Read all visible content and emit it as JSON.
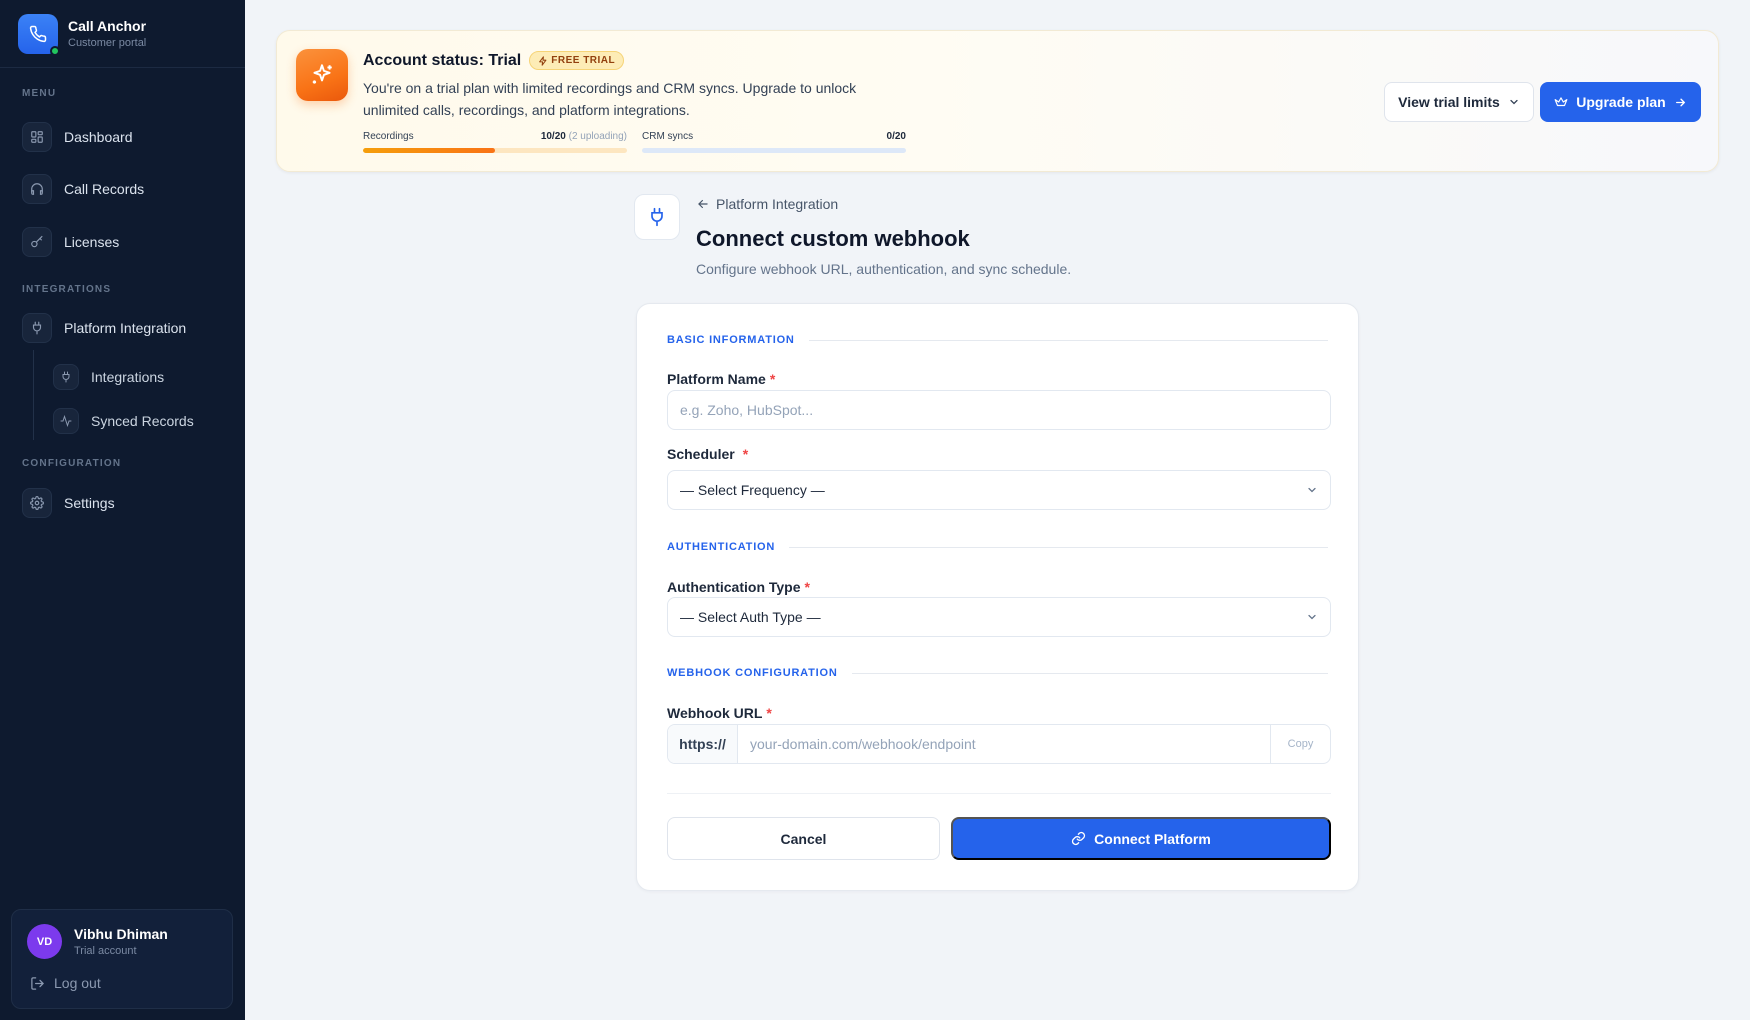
{
  "brand": {
    "name": "Call Anchor",
    "subtitle": "Customer portal"
  },
  "sidebar": {
    "menu_label": "MENU",
    "integrations_label": "INTEGRATIONS",
    "configuration_label": "CONFIGURATION",
    "items": {
      "dashboard": "Dashboard",
      "call_records": "Call Records",
      "licenses": "Licenses",
      "platform_integration": "Platform Integration",
      "integrations": "Integrations",
      "synced_records": "Synced Records",
      "settings": "Settings"
    },
    "user": {
      "initials": "VD",
      "name": "Vibhu Dhiman",
      "role": "Trial account",
      "logout": "Log out"
    }
  },
  "banner": {
    "title": "Account status: Trial",
    "badge": "FREE TRIAL",
    "description": "You're on a trial plan with limited recordings and CRM syncs. Upgrade to unlock unlimited calls, recordings, and platform integrations.",
    "recordings": {
      "label": "Recordings",
      "value": "10/20",
      "note": "(2 uploading)",
      "fraction": 0.5
    },
    "crm": {
      "label": "CRM syncs",
      "value": "0/20",
      "fraction": 0
    },
    "view_limits": "View trial limits",
    "upgrade": "Upgrade plan",
    "accent_color": "#f97316"
  },
  "header": {
    "breadcrumb": "Platform Integration",
    "title": "Connect custom webhook",
    "subtitle": "Configure webhook URL, authentication, and sync schedule."
  },
  "form": {
    "basic_section": "BASIC INFORMATION",
    "platform_name_label": "Platform Name",
    "platform_name_placeholder": "e.g. Zoho, HubSpot...",
    "scheduler_label": "Scheduler",
    "scheduler_value": "— Select Frequency —",
    "auth_section": "AUTHENTICATION",
    "auth_type_label": "Authentication Type",
    "auth_type_value": "— Select Auth Type —",
    "webhook_section": "WEBHOOK CONFIGURATION",
    "webhook_label": "Webhook URL",
    "webhook_prefix": "https://",
    "webhook_placeholder": "your-domain.com/webhook/endpoint",
    "copy": "Copy",
    "required_mark": "*",
    "cancel": "Cancel",
    "connect": "Connect Platform",
    "primary_color": "#2563eb"
  }
}
